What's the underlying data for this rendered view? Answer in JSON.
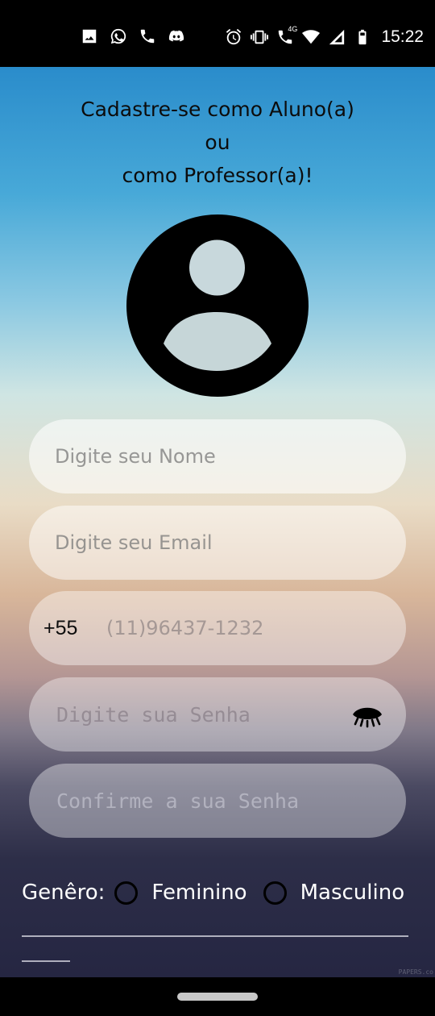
{
  "status_bar": {
    "time": "15:22",
    "network": "4G",
    "left_icons": [
      "image-icon",
      "whatsapp-icon",
      "phone-icon",
      "discord-icon"
    ],
    "right_icons": [
      "alarm-icon",
      "vibrate-icon",
      "volte-call-icon",
      "wifi-icon",
      "signal-icon",
      "battery-icon"
    ]
  },
  "header": {
    "line1": "Cadastre-se como Aluno(a)",
    "line2": "ou",
    "line3": "como Professor(a)!"
  },
  "avatar": {
    "icon": "account-circle-icon"
  },
  "form": {
    "name_placeholder": "Digite seu Nome",
    "email_placeholder": "Digite seu Email",
    "phone_prefix": "+55",
    "phone_placeholder": "(11)96437-1232",
    "password_placeholder": "Digite sua Senha",
    "password_toggle_icon": "eye-closed-icon",
    "confirm_placeholder": "Confirme a sua Senha"
  },
  "gender": {
    "label": "Genêro:",
    "options": [
      "Feminino",
      "Masculino"
    ]
  },
  "watermark": "PAPERS.co",
  "colors": {
    "gradient_top": "#2a8ccb",
    "gradient_mid": "#e9dcc6",
    "gradient_bottom": "#252642",
    "text_dark": "#0c0c0c",
    "text_light": "#ffffff"
  }
}
